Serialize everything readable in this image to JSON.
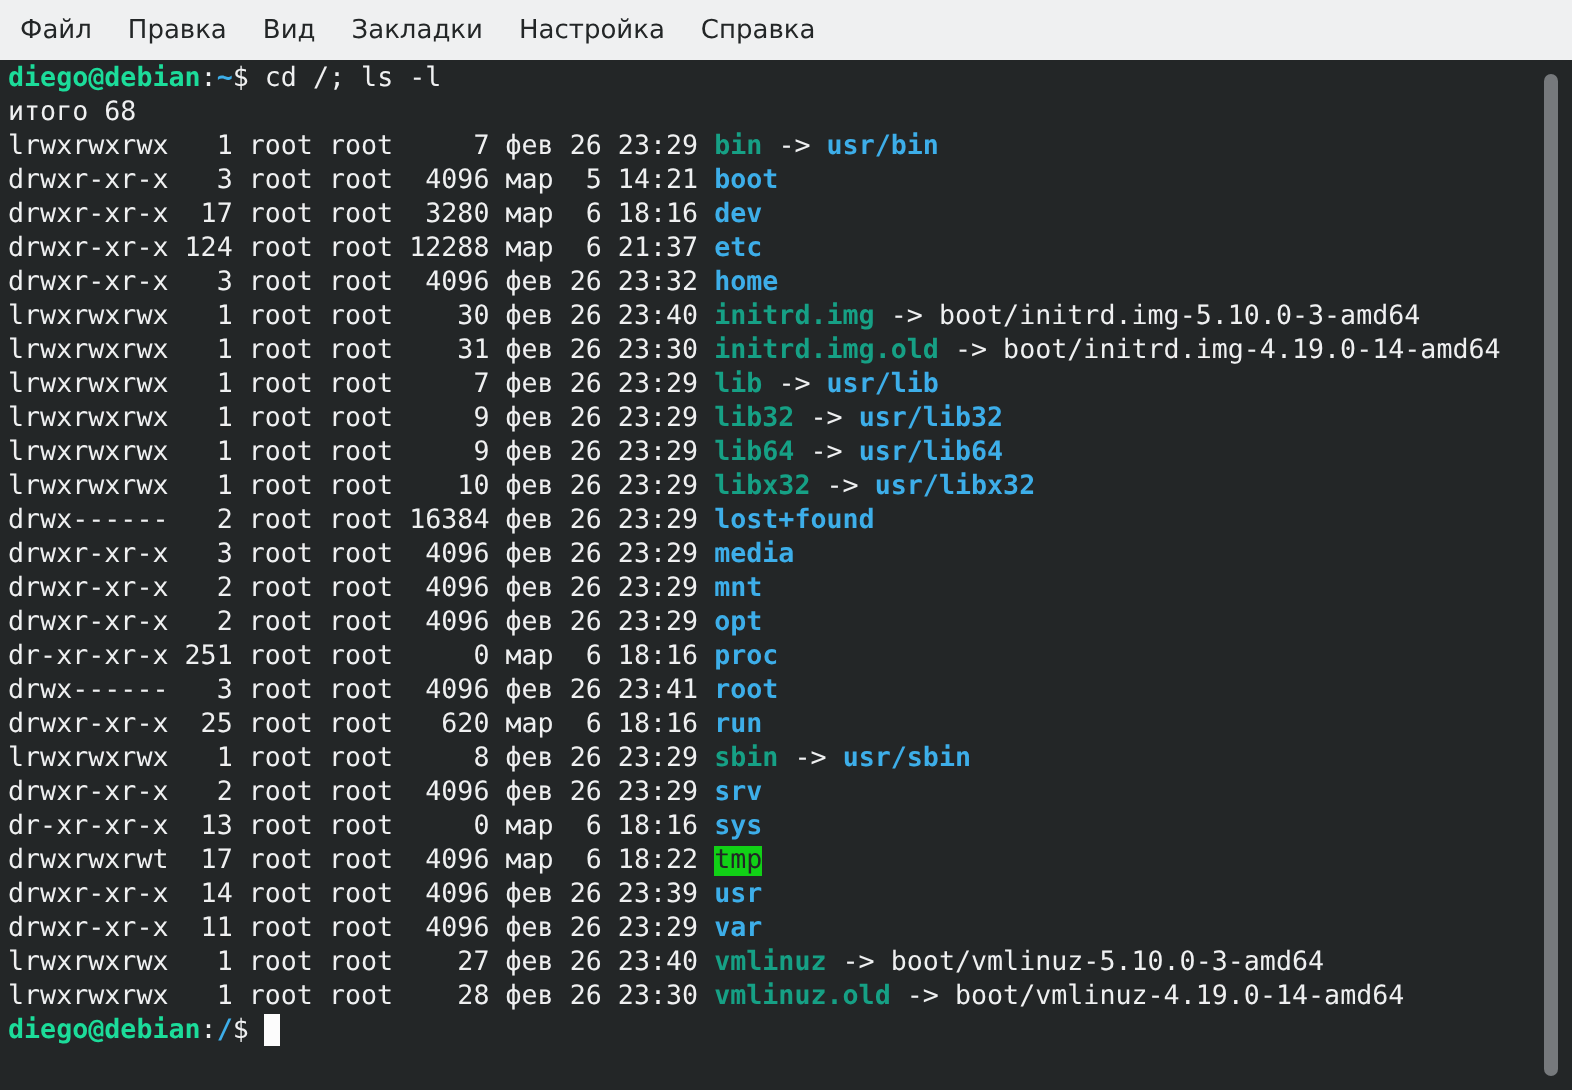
{
  "menu": [
    {
      "label": "Файл"
    },
    {
      "label": "Правка"
    },
    {
      "label": "Вид"
    },
    {
      "label": "Закладки"
    },
    {
      "label": "Настройка"
    },
    {
      "label": "Справка"
    }
  ],
  "terminal": {
    "lines": [
      {
        "segments": [
          {
            "kind": "user",
            "text": "diego@debian"
          },
          {
            "kind": "plain",
            "text": ":"
          },
          {
            "kind": "path",
            "text": "~"
          },
          {
            "kind": "plain",
            "text": "$ cd /; ls -l"
          }
        ]
      },
      {
        "segments": [
          {
            "kind": "plain",
            "text": "итого 68"
          }
        ]
      },
      {
        "segments": [
          {
            "kind": "meta",
            "text": "lrwxrwxrwx   1 root root     7 фев 26 23:29 "
          },
          {
            "kind": "link",
            "text": "bin"
          },
          {
            "kind": "arrow",
            "text": " -> "
          },
          {
            "kind": "dir",
            "text": "usr/bin"
          }
        ]
      },
      {
        "segments": [
          {
            "kind": "meta",
            "text": "drwxr-xr-x   3 root root  4096 мар  5 14:21 "
          },
          {
            "kind": "dir",
            "text": "boot"
          }
        ]
      },
      {
        "segments": [
          {
            "kind": "meta",
            "text": "drwxr-xr-x  17 root root  3280 мар  6 18:16 "
          },
          {
            "kind": "dir",
            "text": "dev"
          }
        ]
      },
      {
        "segments": [
          {
            "kind": "meta",
            "text": "drwxr-xr-x 124 root root 12288 мар  6 21:37 "
          },
          {
            "kind": "dir",
            "text": "etc"
          }
        ]
      },
      {
        "segments": [
          {
            "kind": "meta",
            "text": "drwxr-xr-x   3 root root  4096 фев 26 23:32 "
          },
          {
            "kind": "dir",
            "text": "home"
          }
        ]
      },
      {
        "segments": [
          {
            "kind": "meta",
            "text": "lrwxrwxrwx   1 root root    30 фев 26 23:40 "
          },
          {
            "kind": "link",
            "text": "initrd.img"
          },
          {
            "kind": "arrow",
            "text": " -> "
          },
          {
            "kind": "plain",
            "text": "boot/initrd.img-5.10.0-3-amd64"
          }
        ]
      },
      {
        "segments": [
          {
            "kind": "meta",
            "text": "lrwxrwxrwx   1 root root    31 фев 26 23:30 "
          },
          {
            "kind": "link",
            "text": "initrd.img.old"
          },
          {
            "kind": "arrow",
            "text": " -> "
          },
          {
            "kind": "plain",
            "text": "boot/initrd.img-4.19.0-14-amd64"
          }
        ]
      },
      {
        "segments": [
          {
            "kind": "meta",
            "text": "lrwxrwxrwx   1 root root     7 фев 26 23:29 "
          },
          {
            "kind": "link",
            "text": "lib"
          },
          {
            "kind": "arrow",
            "text": " -> "
          },
          {
            "kind": "dir",
            "text": "usr/lib"
          }
        ]
      },
      {
        "segments": [
          {
            "kind": "meta",
            "text": "lrwxrwxrwx   1 root root     9 фев 26 23:29 "
          },
          {
            "kind": "link",
            "text": "lib32"
          },
          {
            "kind": "arrow",
            "text": " -> "
          },
          {
            "kind": "dir",
            "text": "usr/lib32"
          }
        ]
      },
      {
        "segments": [
          {
            "kind": "meta",
            "text": "lrwxrwxrwx   1 root root     9 фев 26 23:29 "
          },
          {
            "kind": "link",
            "text": "lib64"
          },
          {
            "kind": "arrow",
            "text": " -> "
          },
          {
            "kind": "dir",
            "text": "usr/lib64"
          }
        ]
      },
      {
        "segments": [
          {
            "kind": "meta",
            "text": "lrwxrwxrwx   1 root root    10 фев 26 23:29 "
          },
          {
            "kind": "link",
            "text": "libx32"
          },
          {
            "kind": "arrow",
            "text": " -> "
          },
          {
            "kind": "dir",
            "text": "usr/libx32"
          }
        ]
      },
      {
        "segments": [
          {
            "kind": "meta",
            "text": "drwx------   2 root root 16384 фев 26 23:29 "
          },
          {
            "kind": "dir",
            "text": "lost+found"
          }
        ]
      },
      {
        "segments": [
          {
            "kind": "meta",
            "text": "drwxr-xr-x   3 root root  4096 фев 26 23:29 "
          },
          {
            "kind": "dir",
            "text": "media"
          }
        ]
      },
      {
        "segments": [
          {
            "kind": "meta",
            "text": "drwxr-xr-x   2 root root  4096 фев 26 23:29 "
          },
          {
            "kind": "dir",
            "text": "mnt"
          }
        ]
      },
      {
        "segments": [
          {
            "kind": "meta",
            "text": "drwxr-xr-x   2 root root  4096 фев 26 23:29 "
          },
          {
            "kind": "dir",
            "text": "opt"
          }
        ]
      },
      {
        "segments": [
          {
            "kind": "meta",
            "text": "dr-xr-xr-x 251 root root     0 мар  6 18:16 "
          },
          {
            "kind": "dir",
            "text": "proc"
          }
        ]
      },
      {
        "segments": [
          {
            "kind": "meta",
            "text": "drwx------   3 root root  4096 фев 26 23:41 "
          },
          {
            "kind": "dir",
            "text": "root"
          }
        ]
      },
      {
        "segments": [
          {
            "kind": "meta",
            "text": "drwxr-xr-x  25 root root   620 мар  6 18:16 "
          },
          {
            "kind": "dir",
            "text": "run"
          }
        ]
      },
      {
        "segments": [
          {
            "kind": "meta",
            "text": "lrwxrwxrwx   1 root root     8 фев 26 23:29 "
          },
          {
            "kind": "link",
            "text": "sbin"
          },
          {
            "kind": "arrow",
            "text": " -> "
          },
          {
            "kind": "dir",
            "text": "usr/sbin"
          }
        ]
      },
      {
        "segments": [
          {
            "kind": "meta",
            "text": "drwxr-xr-x   2 root root  4096 фев 26 23:29 "
          },
          {
            "kind": "dir",
            "text": "srv"
          }
        ]
      },
      {
        "segments": [
          {
            "kind": "meta",
            "text": "dr-xr-xr-x  13 root root     0 мар  6 18:16 "
          },
          {
            "kind": "dir",
            "text": "sys"
          }
        ]
      },
      {
        "segments": [
          {
            "kind": "meta",
            "text": "drwxrwxrwt  17 root root  4096 мар  6 18:22 "
          },
          {
            "kind": "sticky",
            "text": "tmp"
          }
        ]
      },
      {
        "segments": [
          {
            "kind": "meta",
            "text": "drwxr-xr-x  14 root root  4096 фев 26 23:39 "
          },
          {
            "kind": "dir",
            "text": "usr"
          }
        ]
      },
      {
        "segments": [
          {
            "kind": "meta",
            "text": "drwxr-xr-x  11 root root  4096 фев 26 23:29 "
          },
          {
            "kind": "dir",
            "text": "var"
          }
        ]
      },
      {
        "segments": [
          {
            "kind": "meta",
            "text": "lrwxrwxrwx   1 root root    27 фев 26 23:40 "
          },
          {
            "kind": "link",
            "text": "vmlinuz"
          },
          {
            "kind": "arrow",
            "text": " -> "
          },
          {
            "kind": "plain",
            "text": "boot/vmlinuz-5.10.0-3-amd64"
          }
        ]
      },
      {
        "segments": [
          {
            "kind": "meta",
            "text": "lrwxrwxrwx   1 root root    28 фев 26 23:30 "
          },
          {
            "kind": "link",
            "text": "vmlinuz.old"
          },
          {
            "kind": "arrow",
            "text": " -> "
          },
          {
            "kind": "plain",
            "text": "boot/vmlinuz-4.19.0-14-amd64"
          }
        ]
      },
      {
        "segments": [
          {
            "kind": "user",
            "text": "diego@debian"
          },
          {
            "kind": "plain",
            "text": ":"
          },
          {
            "kind": "path",
            "text": "/"
          },
          {
            "kind": "plain",
            "text": "$ "
          }
        ],
        "cursor": true
      }
    ]
  }
}
